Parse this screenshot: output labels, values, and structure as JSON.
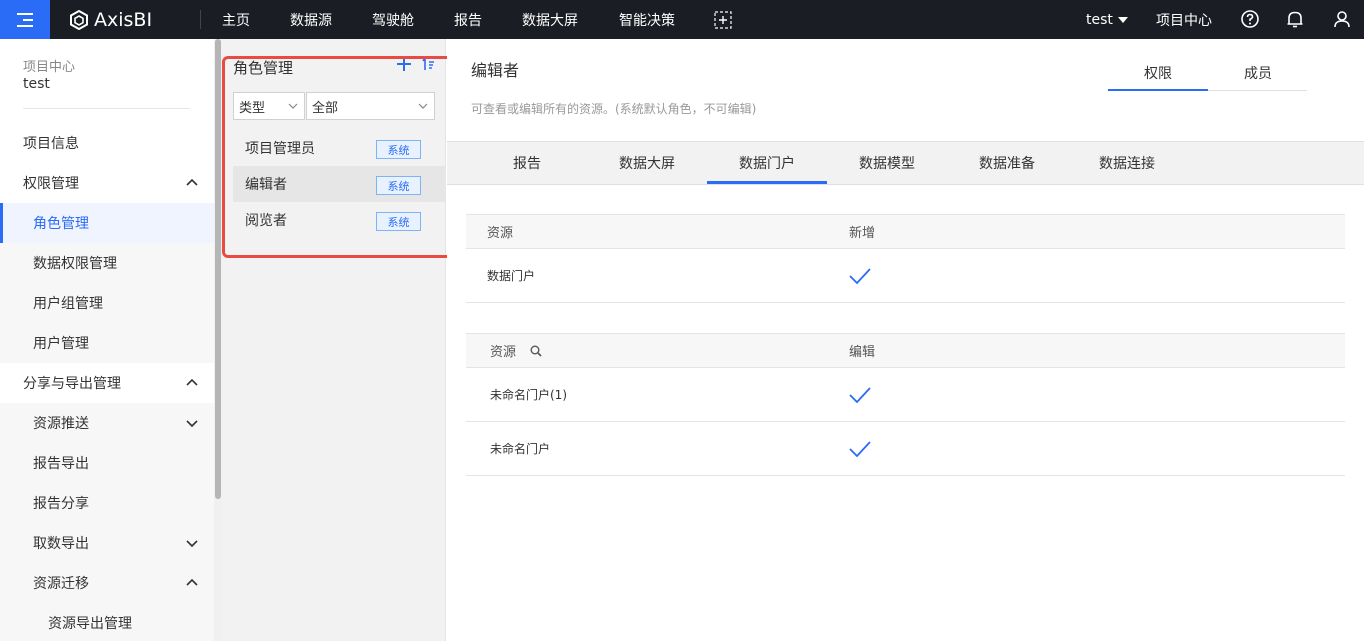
{
  "app": {
    "name": "AxisBI"
  },
  "nav": {
    "items": [
      "主页",
      "数据源",
      "驾驶舱",
      "报告",
      "数据大屏",
      "智能决策"
    ]
  },
  "top_right": {
    "user": "test",
    "project_center": "项目中心"
  },
  "sidebar": {
    "project_label": "项目中心",
    "project_name": "test",
    "items": [
      {
        "label": "项目信息"
      },
      {
        "label": "权限管理"
      },
      {
        "label": "角色管理"
      },
      {
        "label": "数据权限管理"
      },
      {
        "label": "用户组管理"
      },
      {
        "label": "用户管理"
      },
      {
        "label": "分享与导出管理"
      },
      {
        "label": "资源推送"
      },
      {
        "label": "报告导出"
      },
      {
        "label": "报告分享"
      },
      {
        "label": "取数导出"
      },
      {
        "label": "资源迁移"
      },
      {
        "label": "资源导出管理"
      }
    ]
  },
  "role_panel": {
    "title": "角色管理",
    "type_filter": "类型",
    "all_filter": "全部",
    "roles": [
      {
        "name": "项目管理员",
        "badge": "系统"
      },
      {
        "name": "编辑者",
        "badge": "系统"
      },
      {
        "name": "阅览者",
        "badge": "系统"
      }
    ]
  },
  "content": {
    "title": "编辑者",
    "description": "可查看或编辑所有的资源。(系统默认角色，不可编辑)",
    "panel_tabs": [
      "权限",
      "成员"
    ],
    "resource_tabs": [
      "报告",
      "数据大屏",
      "数据门户",
      "数据模型",
      "数据准备",
      "数据连接"
    ],
    "table1": {
      "col_resource": "资源",
      "col_perm": "新增",
      "rows": [
        {
          "name": "数据门户"
        }
      ]
    },
    "table2": {
      "col_resource": "资源",
      "col_perm": "编辑",
      "rows": [
        {
          "name": "未命名门户(1)"
        },
        {
          "name": "未命名门户"
        }
      ]
    }
  },
  "colors": {
    "accent": "#2a6cf5",
    "topbar": "#1b1d24",
    "highlight": "#e94b43"
  }
}
